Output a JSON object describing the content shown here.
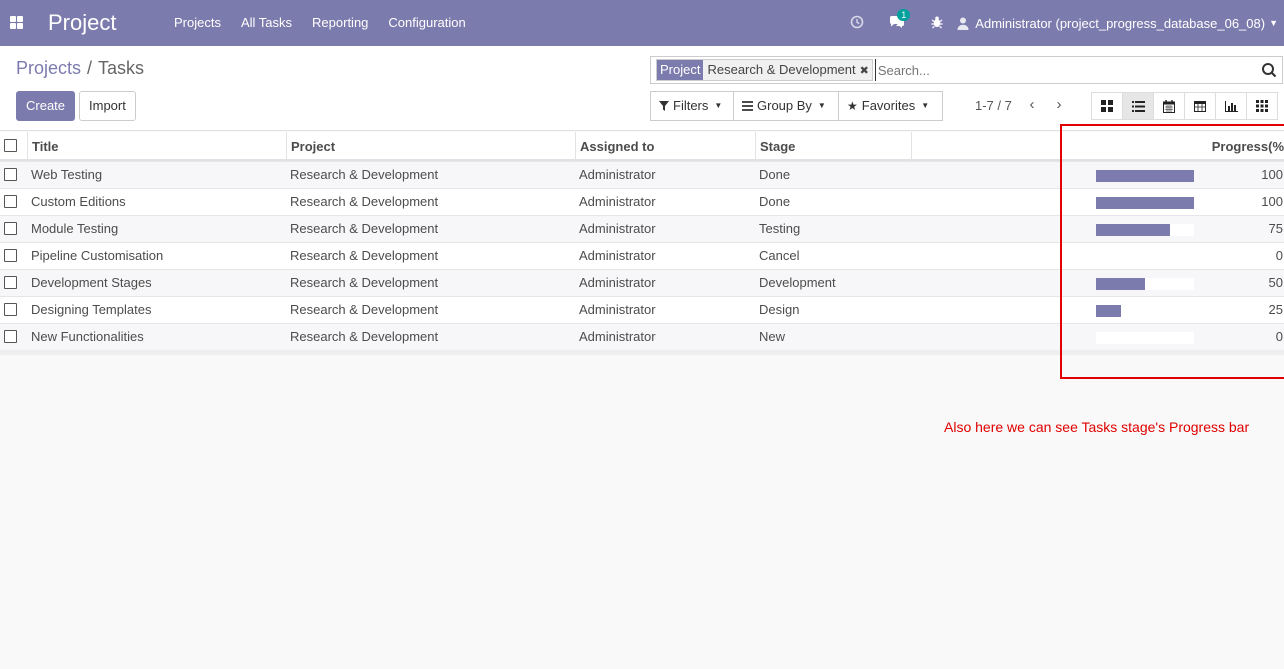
{
  "navbar": {
    "app_title": "Project",
    "menu": [
      "Projects",
      "All Tasks",
      "Reporting",
      "Configuration"
    ],
    "icons": [
      "clock-icon",
      "chat-icon",
      "bug-icon"
    ],
    "chat_badge": "1",
    "user": "Administrator (project_progress_database_06_08)",
    "bg_color": "#7c7bad"
  },
  "breadcrumb": {
    "parent": "Projects",
    "separator": "/",
    "current": "Tasks"
  },
  "buttons": {
    "create": "Create",
    "import": "Import"
  },
  "search": {
    "facet_category": "Project",
    "facet_value": "Research & Development",
    "placeholder": "Search..."
  },
  "filters": {
    "filters": "Filters",
    "group_by": "Group By",
    "favorites": "Favorites"
  },
  "pager": {
    "text": "1-7 / 7"
  },
  "views": [
    "kanban-view-icon",
    "list-view-icon",
    "calendar-view-icon",
    "pivot-view-icon",
    "graph-view-icon",
    "activity-view-icon"
  ],
  "table": {
    "headers": [
      "Title",
      "Project",
      "Assigned to",
      "Stage",
      "Progress(%"
    ],
    "rows": [
      {
        "title": "Web Testing",
        "project": "Research & Development",
        "assigned": "Administrator",
        "stage": "Done",
        "progress": 100,
        "progress_label": "100"
      },
      {
        "title": "Custom Editions",
        "project": "Research & Development",
        "assigned": "Administrator",
        "stage": "Done",
        "progress": 100,
        "progress_label": "100"
      },
      {
        "title": "Module Testing",
        "project": "Research & Development",
        "assigned": "Administrator",
        "stage": "Testing",
        "progress": 75,
        "progress_label": "75"
      },
      {
        "title": "Pipeline Customisation",
        "project": "Research & Development",
        "assigned": "Administrator",
        "stage": "Cancel",
        "progress": 0,
        "progress_label": "0"
      },
      {
        "title": "Development Stages",
        "project": "Research & Development",
        "assigned": "Administrator",
        "stage": "Development",
        "progress": 50,
        "progress_label": "50"
      },
      {
        "title": "Designing Templates",
        "project": "Research & Development",
        "assigned": "Administrator",
        "stage": "Design",
        "progress": 25,
        "progress_label": "25"
      },
      {
        "title": "New Functionalities",
        "project": "Research & Development",
        "assigned": "Administrator",
        "stage": "New",
        "progress": 0,
        "progress_label": "0"
      }
    ]
  },
  "annotation": {
    "text": "Also here we can see Tasks stage's Progress bar",
    "color": "#e00000"
  }
}
